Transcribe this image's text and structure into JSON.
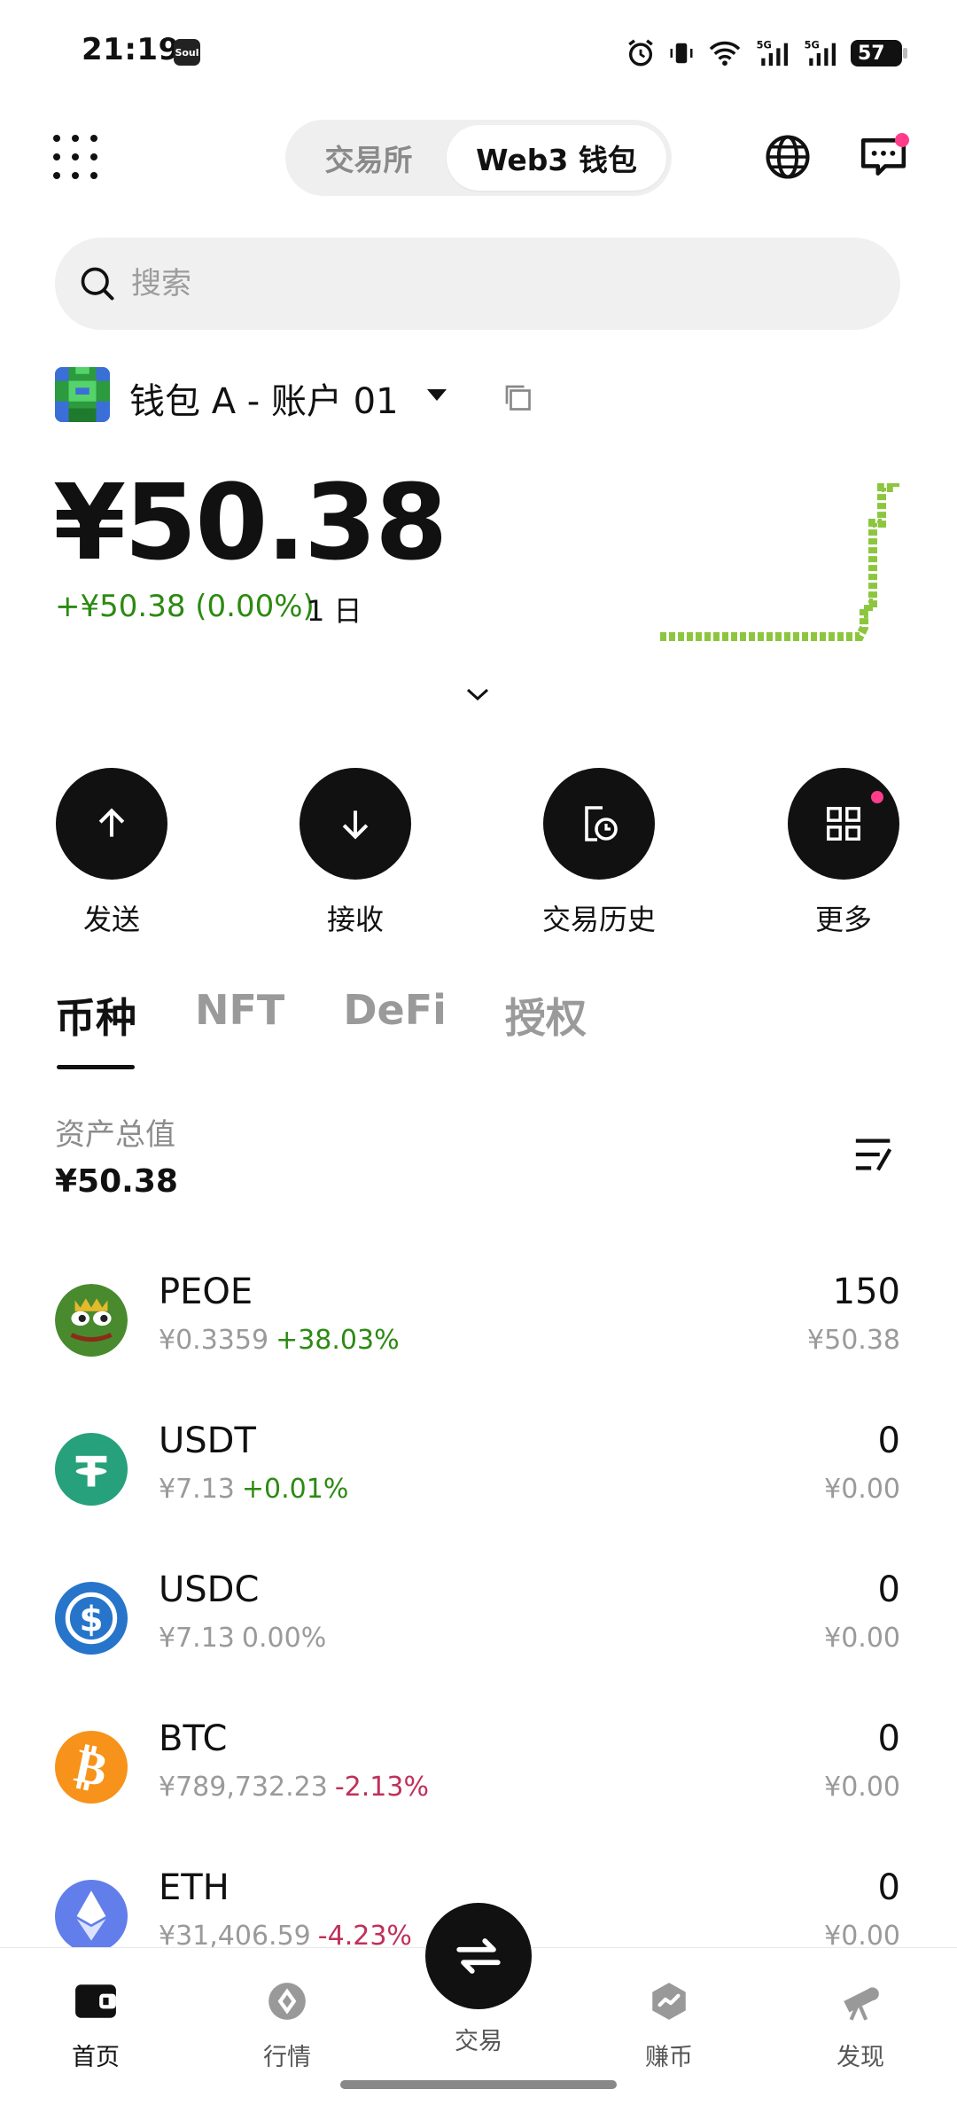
{
  "status_bar": {
    "time": "21:19",
    "app_badge": "Soul",
    "battery": "57",
    "network": "5G"
  },
  "header": {
    "segments": [
      {
        "label": "交易所",
        "active": false
      },
      {
        "label": "Web3 钱包",
        "active": true
      }
    ],
    "icons": [
      "globe-icon",
      "message-icon"
    ]
  },
  "search": {
    "placeholder": "搜索"
  },
  "wallet": {
    "name": "钱包 A - 账户 01",
    "balance": "¥50.38",
    "change": "+¥50.38 (0.00%)",
    "period": "1 日"
  },
  "actions": [
    {
      "label": "发送",
      "icon": "arrow-up-icon"
    },
    {
      "label": "接收",
      "icon": "arrow-down-icon"
    },
    {
      "label": "交易历史",
      "icon": "history-icon"
    },
    {
      "label": "更多",
      "icon": "grid-icon"
    }
  ],
  "tabs": [
    {
      "label": "币种",
      "active": true
    },
    {
      "label": "NFT",
      "active": false
    },
    {
      "label": "DeFi",
      "active": false
    },
    {
      "label": "授权",
      "active": false
    }
  ],
  "assets": {
    "total_label": "资产总值",
    "total_value": "¥50.38"
  },
  "tokens": [
    {
      "symbol": "PEOE",
      "price": "¥0.3359",
      "change": "+38.03%",
      "trend": "pos",
      "amount": "150",
      "value": "¥50.38"
    },
    {
      "symbol": "USDT",
      "price": "¥7.13",
      "change": "+0.01%",
      "trend": "pos",
      "amount": "0",
      "value": "¥0.00"
    },
    {
      "symbol": "USDC",
      "price": "¥7.13",
      "change": "0.00%",
      "trend": "neutral",
      "amount": "0",
      "value": "¥0.00"
    },
    {
      "symbol": "BTC",
      "price": "¥789,732.23",
      "change": "-2.13%",
      "trend": "neg",
      "amount": "0",
      "value": "¥0.00"
    },
    {
      "symbol": "ETH",
      "price": "¥31,406.59",
      "change": "-4.23%",
      "trend": "neg",
      "amount": "0",
      "value": "¥0.00"
    }
  ],
  "bottom_nav": {
    "items": [
      {
        "label": "首页",
        "icon": "wallet-icon",
        "active": true
      },
      {
        "label": "行情",
        "icon": "market-icon",
        "active": false
      },
      {
        "label": "交易",
        "icon": "swap-icon",
        "active": false
      },
      {
        "label": "赚币",
        "icon": "earn-icon",
        "active": false
      },
      {
        "label": "发现",
        "icon": "telescope-icon",
        "active": false
      }
    ]
  },
  "colors": {
    "positive": "#2c8a12",
    "negative": "#c0305a",
    "accent_dot": "#ff3d8b",
    "sparkline": "#8cc63f"
  }
}
